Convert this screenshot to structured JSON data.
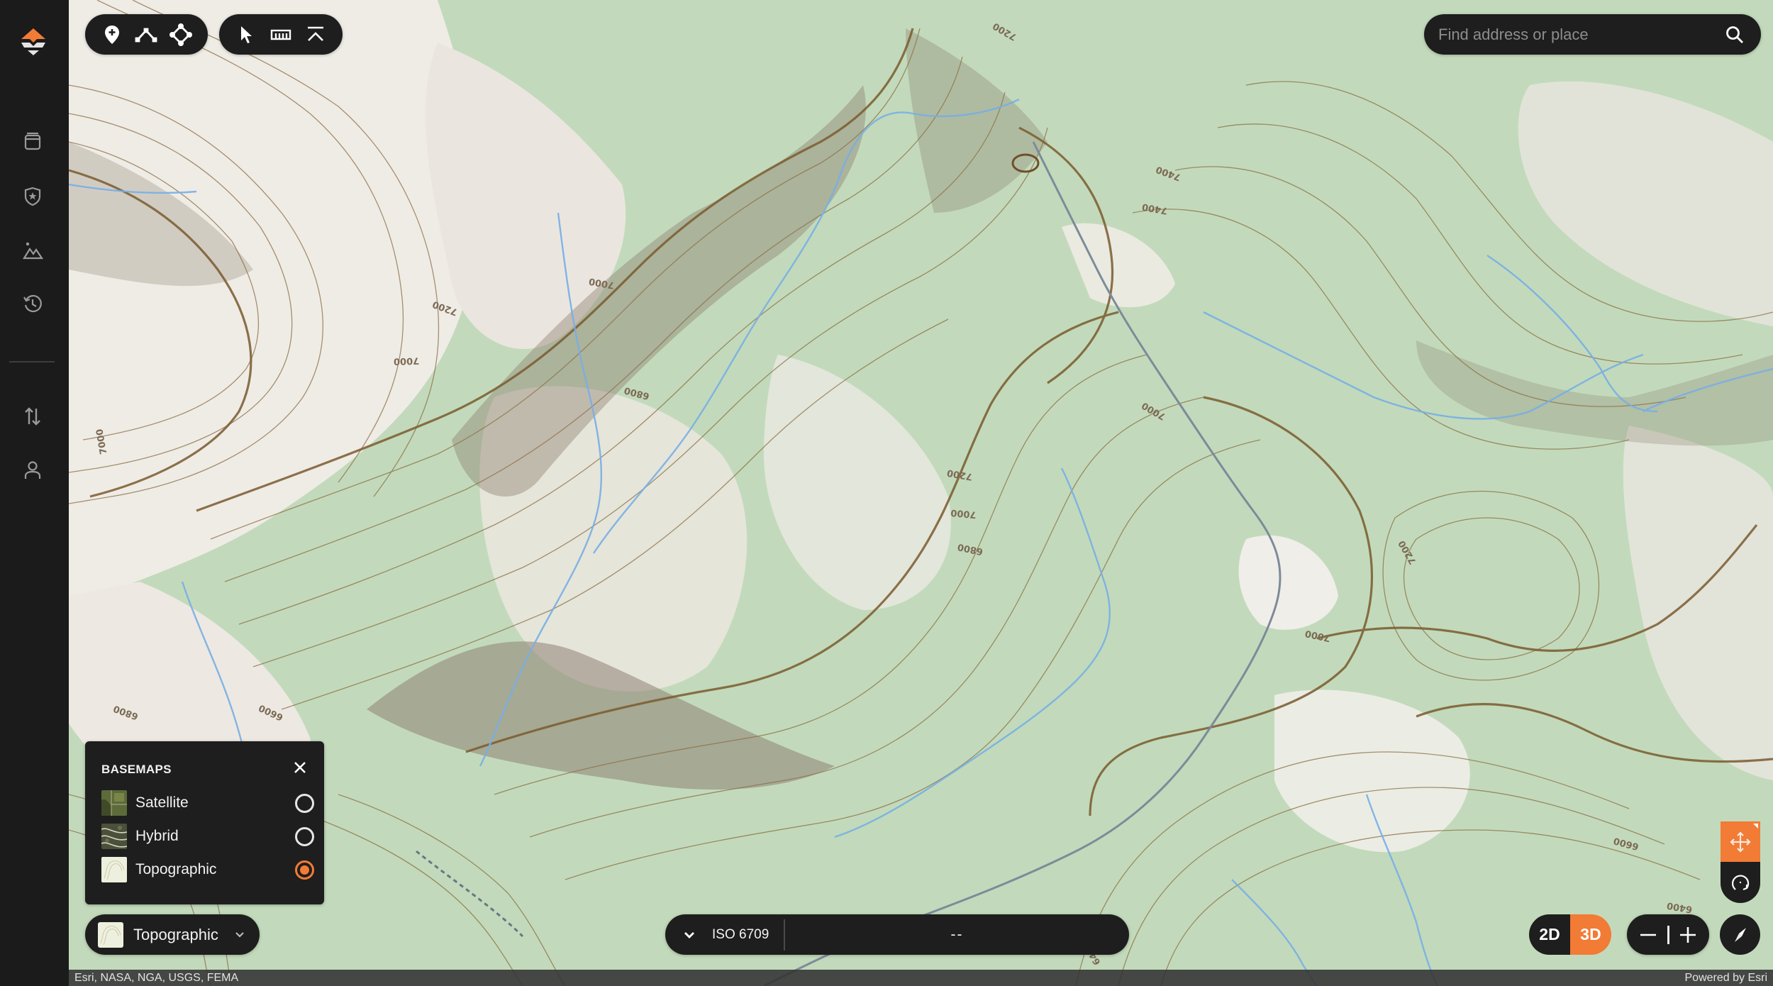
{
  "app": {
    "brand_color": "#f27b35",
    "panel_color": "#1e1e1e"
  },
  "sidebar": {
    "logo": "onx-logo-icon",
    "items": [
      {
        "name": "sidebar-item-layers",
        "icon": "layers-icon"
      },
      {
        "name": "sidebar-item-land-status",
        "icon": "shield-star-icon"
      },
      {
        "name": "sidebar-item-terrain",
        "icon": "mountain-icon"
      },
      {
        "name": "sidebar-item-history",
        "icon": "history-icon"
      },
      {
        "name": "sidebar-item-import-export",
        "icon": "arrows-up-down-icon"
      },
      {
        "name": "sidebar-item-account",
        "icon": "user-icon"
      }
    ]
  },
  "toolbar": {
    "group1": [
      {
        "name": "add-waypoint-tool",
        "icon": "map-pin-plus-icon"
      },
      {
        "name": "draw-line-tool",
        "icon": "line-icon"
      },
      {
        "name": "draw-shape-tool",
        "icon": "polygon-icon"
      }
    ],
    "group2": [
      {
        "name": "select-tool",
        "icon": "cursor-icon"
      },
      {
        "name": "measure-tool",
        "icon": "ruler-icon"
      },
      {
        "name": "elevation-profile-tool",
        "icon": "profile-icon"
      }
    ]
  },
  "search": {
    "placeholder": "Find address or place",
    "value": ""
  },
  "basemaps": {
    "title": "BASEMAPS",
    "options": [
      {
        "label": "Satellite",
        "selected": false
      },
      {
        "label": "Hybrid",
        "selected": false
      },
      {
        "label": "Topographic",
        "selected": true
      }
    ]
  },
  "basemap_selector": {
    "label": "Topographic"
  },
  "coordinates": {
    "format": "ISO 6709",
    "value": "--"
  },
  "view_mode": {
    "options": [
      "2D",
      "3D"
    ],
    "active": "3D"
  },
  "navigation": {
    "mode": "pan",
    "zoom_out": "zoom-out",
    "zoom_in": "zoom-in"
  },
  "map": {
    "contour_labels": [
      "7000",
      "7000",
      "7000",
      "7000",
      "7000",
      "6800",
      "6800",
      "7200",
      "7200",
      "7200",
      "7400",
      "6600",
      "6600",
      "6400",
      "6400",
      "7000",
      "6800",
      "7200",
      "7400"
    ]
  },
  "attribution": {
    "sources": "Esri, NASA, NGA, USGS, FEMA",
    "powered_by": "Powered by Esri"
  }
}
